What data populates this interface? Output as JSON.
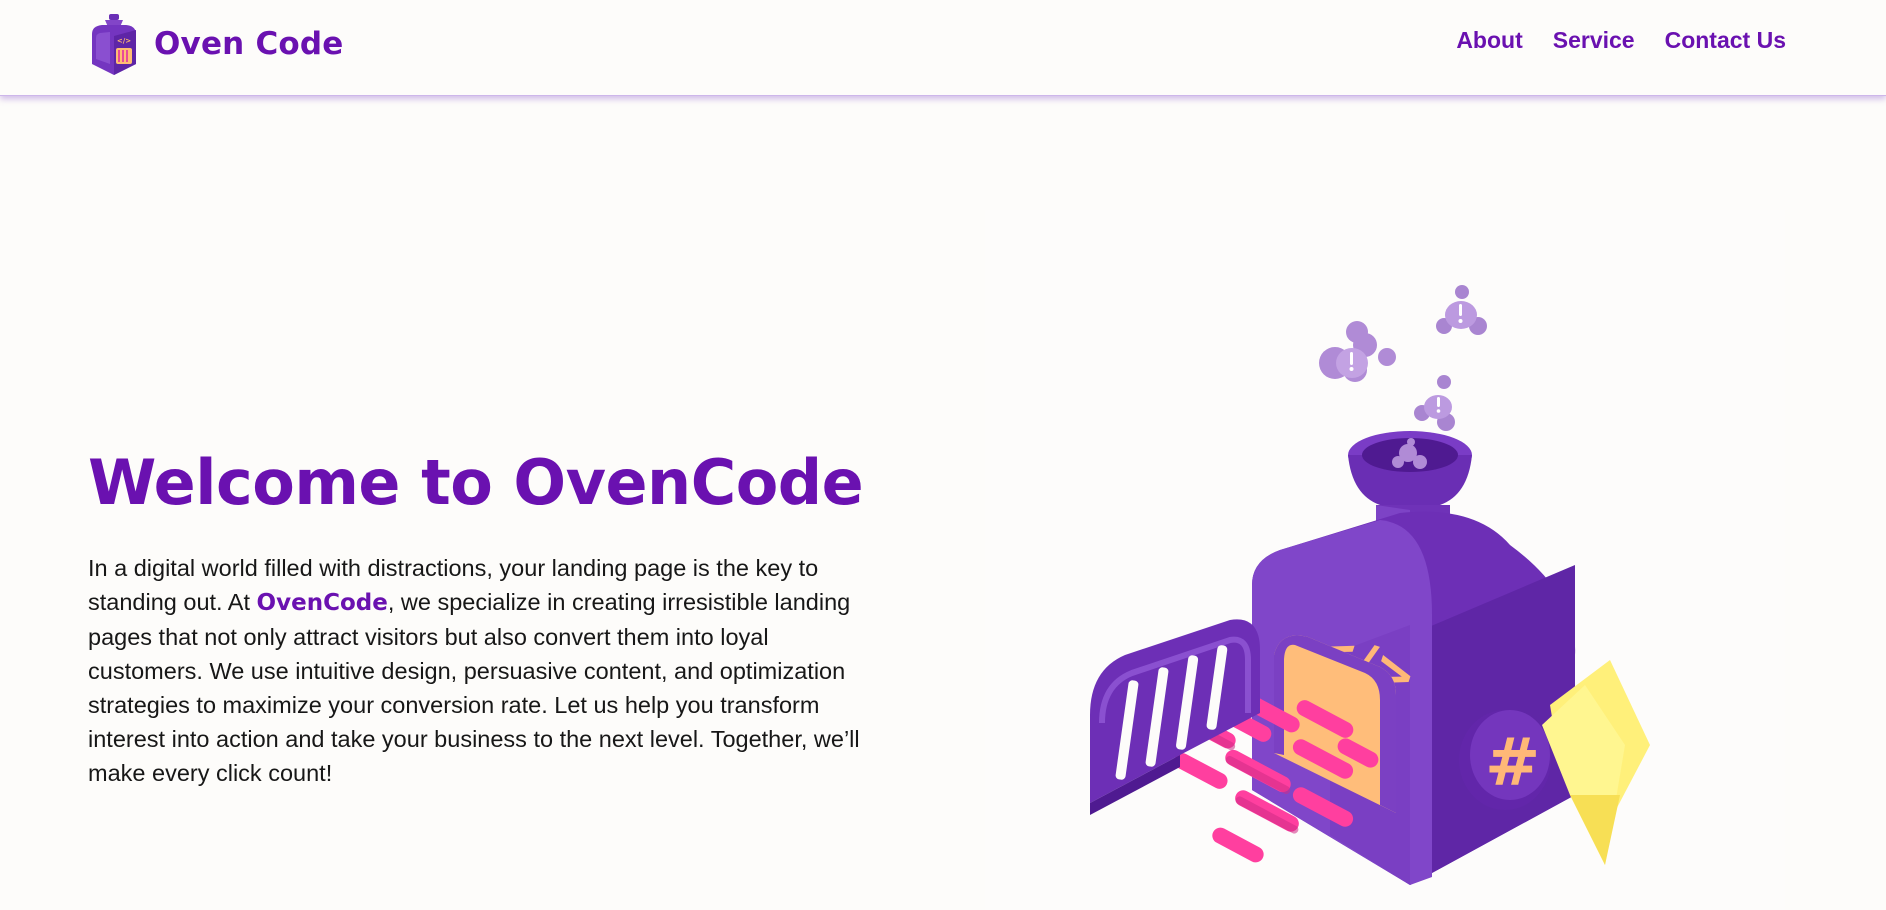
{
  "header": {
    "brand_name": "Oven Code",
    "logo_icon": "oven-logo-icon",
    "nav": [
      {
        "label": "About"
      },
      {
        "label": "Service"
      },
      {
        "label": "Contact Us"
      }
    ]
  },
  "hero": {
    "title": "Welcome to OvenCode",
    "text_before": "In a digital world filled with distractions, your landing page is the key to standing out. At ",
    "brand_highlight": "OvenCode",
    "text_after": ", we specialize in creating irresistible landing pages that not only attract visitors but also convert them into loyal customers. We use intuitive design, persuasive content, and optimization strategies to maximize your conversion rate. Let us help you transform interest into action and take your business to the next level. Together, we’ll make every click count!"
  },
  "illustration": {
    "icon": "code-oven-illustration",
    "door_symbol": "</>",
    "side_symbol": "#"
  },
  "colors": {
    "brand_purple": "#6a11b0",
    "oven_purple": "#7a3cc6",
    "oven_glow": "#ffbf7a",
    "bars_pink": "#ff3fa0",
    "folder_yellow": "#fff580",
    "smoke_lilac": "#b38fd8"
  }
}
